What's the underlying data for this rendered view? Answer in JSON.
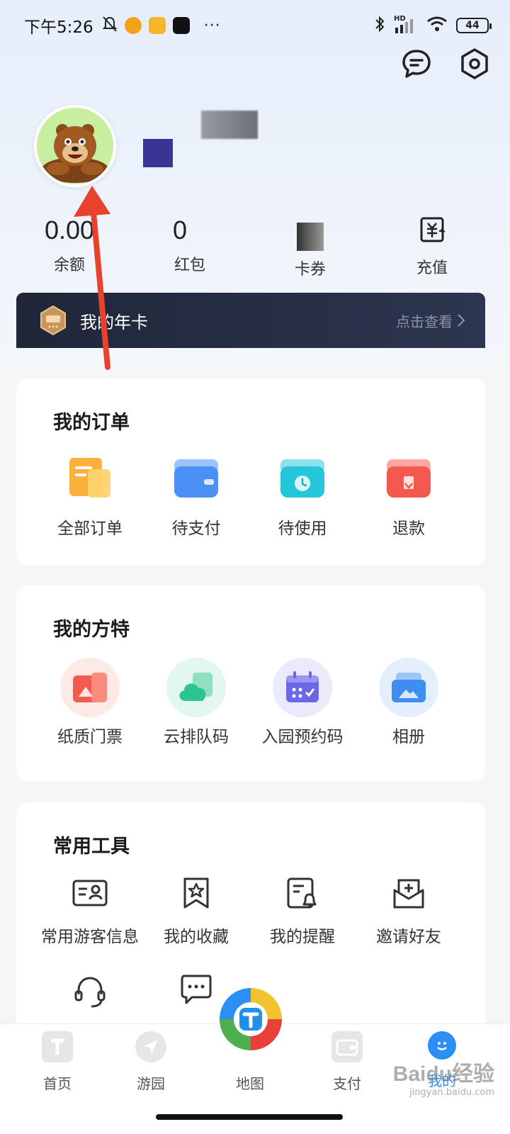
{
  "status_bar": {
    "time": "下午5:26",
    "more": "···",
    "network": "HD",
    "battery": "44"
  },
  "profile": {
    "avatar": "bear-avatar"
  },
  "stats": [
    {
      "value": "0.00",
      "label": "余额"
    },
    {
      "value": "0",
      "label": "红包"
    },
    {
      "value": "",
      "label": "卡券"
    },
    {
      "value": "",
      "label": "充值"
    }
  ],
  "annual_card": {
    "title": "我的年卡",
    "link": "点击查看"
  },
  "orders": {
    "title": "我的订单",
    "items": [
      {
        "label": "全部订单",
        "icon": "all-orders-icon",
        "color": "#fbb03b"
      },
      {
        "label": "待支付",
        "icon": "wallet-icon",
        "color": "#4a90f5"
      },
      {
        "label": "待使用",
        "icon": "clock-icon",
        "color": "#26c6da"
      },
      {
        "label": "退款",
        "icon": "refund-icon",
        "color": "#f5584f"
      }
    ]
  },
  "fangte": {
    "title": "我的方特",
    "items": [
      {
        "label": "纸质门票",
        "icon": "ticket-icon",
        "color": "#f35b4f"
      },
      {
        "label": "云排队码",
        "icon": "cloud-icon",
        "color": "#2ec48f"
      },
      {
        "label": "入园预约码",
        "icon": "calendar-icon",
        "color": "#6b68e8"
      },
      {
        "label": "相册",
        "icon": "album-icon",
        "color": "#3d8ef0"
      }
    ]
  },
  "tools": {
    "title": "常用工具",
    "items": [
      {
        "label": "常用游客信息",
        "icon": "id-card-icon"
      },
      {
        "label": "我的收藏",
        "icon": "bookmark-star-icon"
      },
      {
        "label": "我的提醒",
        "icon": "reminder-icon"
      },
      {
        "label": "邀请好友",
        "icon": "invite-icon"
      },
      {
        "label": "",
        "icon": "headset-icon"
      },
      {
        "label": "",
        "icon": "feedback-icon"
      }
    ]
  },
  "bottom_nav": [
    {
      "label": "首页",
      "icon": "home-icon"
    },
    {
      "label": "游园",
      "icon": "navigate-icon"
    },
    {
      "label": "地图",
      "icon": "map-icon"
    },
    {
      "label": "支付",
      "icon": "wallet-icon"
    },
    {
      "label": "我的",
      "icon": "profile-icon"
    }
  ],
  "watermark": {
    "brand": "Baidu经验",
    "url": "jingyan.baidu.com"
  },
  "colors": {
    "annual_card_bg": "#1f2638",
    "accent": "#2b8ff5",
    "annotation_arrow": "#e8412c"
  }
}
